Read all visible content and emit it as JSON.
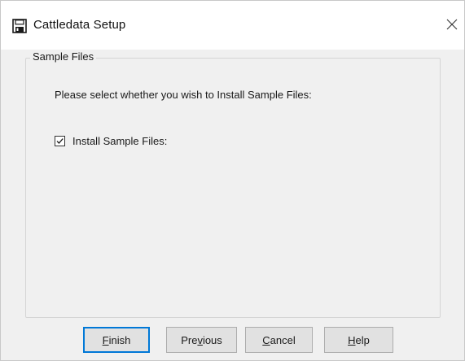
{
  "window": {
    "title": "Cattledata Setup",
    "icon": "floppy-disk-icon",
    "close_icon": "close-icon"
  },
  "group": {
    "legend": "Sample Files",
    "instruction": "Please select whether you wish to Install Sample Files:"
  },
  "checkbox": {
    "label": "Install Sample Files:",
    "checked": true
  },
  "buttons": {
    "finish": {
      "label": "Finish",
      "accesskey": "F",
      "rest": "inish"
    },
    "previous": {
      "label": "Previous",
      "before": "Pre",
      "accesskey": "v",
      "after": "ious"
    },
    "cancel": {
      "label": "Cancel",
      "accesskey": "C",
      "rest": "ancel"
    },
    "help": {
      "label": "Help",
      "accesskey": "H",
      "rest": "elp"
    }
  },
  "colors": {
    "focus_border": "#0078d7",
    "dialog_bg": "#f0f0f0"
  }
}
